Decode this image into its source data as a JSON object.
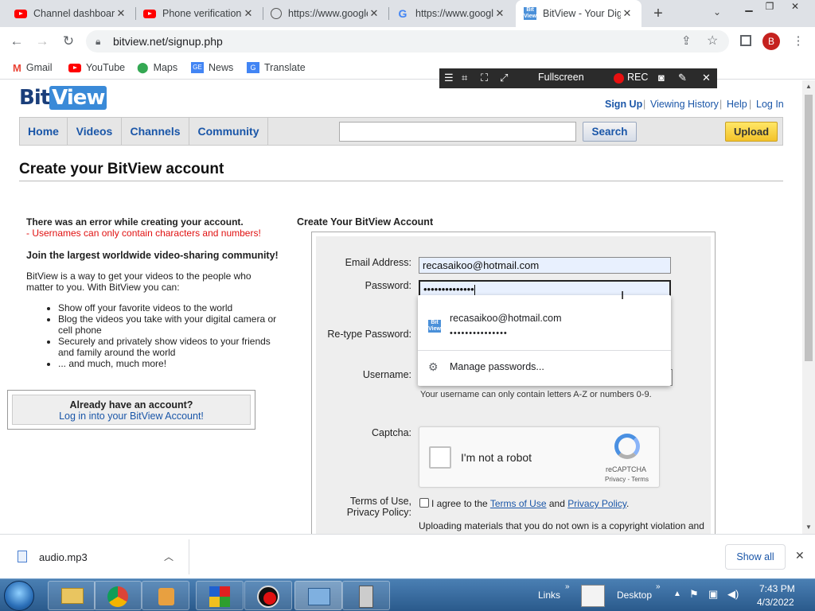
{
  "browser": {
    "tabs": [
      {
        "title": "Channel dashboard",
        "icon": "youtube-icon",
        "active": false
      },
      {
        "title": "Phone verification",
        "icon": "youtube-icon",
        "active": false
      },
      {
        "title": "https://www.google",
        "icon": "globe-icon",
        "active": false
      },
      {
        "title": "https://www.google",
        "icon": "google-icon",
        "active": false
      },
      {
        "title": "BitView - Your Digital",
        "icon": "bitview-icon",
        "active": true
      }
    ],
    "new_tab": "+",
    "url": "bitview.net/signup.php",
    "profile_initial": "B",
    "bookmarks": [
      "Gmail",
      "YouTube",
      "Maps",
      "News",
      "Translate"
    ]
  },
  "recorder": {
    "fullscreen_label": "Fullscreen",
    "rec_label": "REC"
  },
  "site": {
    "logo_bit": "Bit",
    "logo_view": "View",
    "top_links": [
      "Sign Up",
      "Viewing History",
      "Help",
      "Log In"
    ],
    "top_link_sep": "|",
    "nav": [
      "Home",
      "Videos",
      "Channels",
      "Community"
    ],
    "search_label": "Search",
    "upload_label": "Upload",
    "page_title": "Create your BitView account",
    "error_heading": "There was an error while creating your account.",
    "error_message": "- Usernames can only contain characters and numbers!",
    "join_heading": "Join the largest worldwide video-sharing community!",
    "intro": "BitView is a way to get your videos to the people who matter to you. With BitView you can:",
    "bullets": [
      "Show off your favorite videos to the world",
      "Blog the videos you take with your digital camera or cell phone",
      "Securely and privately show videos to your friends and family around the world",
      "... and much, much more!"
    ],
    "already_account": "Already have an account?",
    "login_link": "Log in into your BitView Account!"
  },
  "form": {
    "title": "Create Your BitView Account",
    "email_label": "Email Address:",
    "email_value": "recasaikoo@hotmail.com",
    "password_label": "Password:",
    "password_value": "••••••••••••••",
    "retype_label": "Re-type Password:",
    "username_label": "Username:",
    "username_note": "Your username can only contain letters A-Z or numbers 0-9.",
    "captcha_label": "Captcha:",
    "captcha_text": "I'm not a robot",
    "captcha_brand": "reCAPTCHA",
    "captcha_links": "Privacy - Terms",
    "terms_label_1": "Terms of Use,",
    "terms_label_2": "Privacy Policy:",
    "agree_pre": "I agree to the",
    "terms_link": "Terms of Use",
    "agree_and": "and",
    "privacy_link": "Privacy Policy",
    "agree_post": ".",
    "copyright_note": "Uploading materials that you do not own is a copyright violation and"
  },
  "autofill": {
    "account_email": "recasaikoo@hotmail.com",
    "account_password": "•••••••••••••••",
    "manage": "Manage passwords..."
  },
  "downloads": {
    "file": "audio.mp3",
    "show_all": "Show all"
  },
  "taskbar": {
    "links": "Links",
    "desktop": "Desktop",
    "time": "7:43 PM",
    "date": "4/3/2022"
  }
}
